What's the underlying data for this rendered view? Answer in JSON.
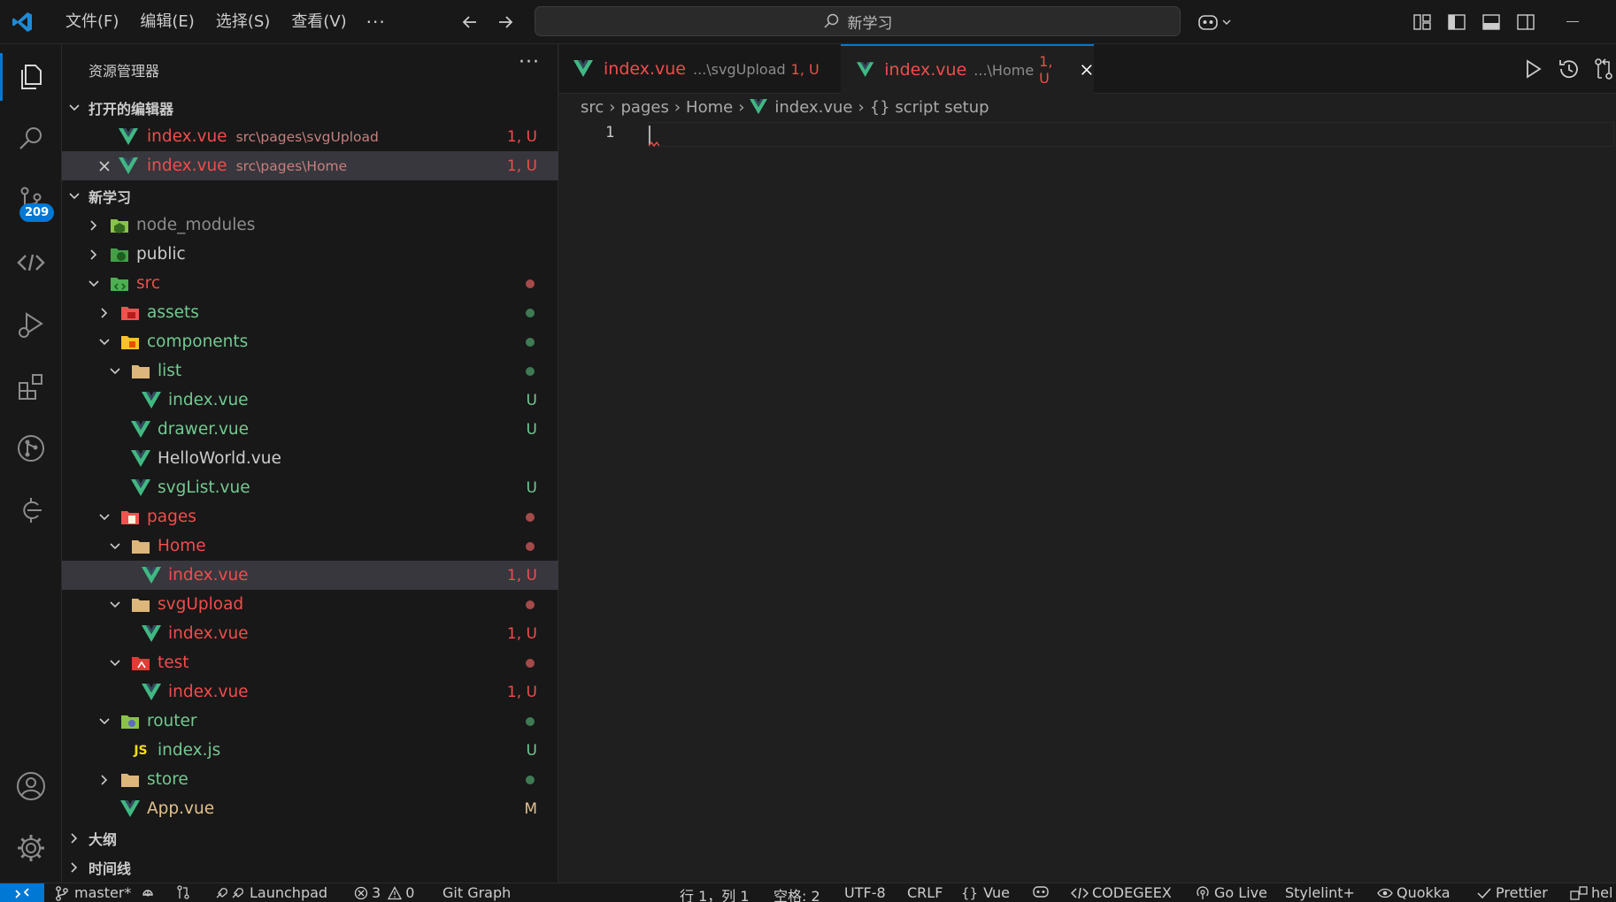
{
  "titlebar": {
    "menus": [
      "文件(F)",
      "编辑(E)",
      "选择(S)",
      "查看(V)"
    ],
    "more": "···",
    "search_text": "新学习"
  },
  "activity": {
    "scm_badge": "209"
  },
  "sidebar": {
    "title": "资源管理器",
    "more": "···",
    "open_editors": {
      "header": "打开的编辑器",
      "items": [
        {
          "name": "index.vue",
          "path": "src\\pages\\svgUpload",
          "status": "1, U"
        },
        {
          "name": "index.vue",
          "path": "src\\pages\\Home",
          "status": "1, U"
        }
      ]
    },
    "workspace": {
      "header": "新学习",
      "tree": [
        {
          "name": "node_modules"
        },
        {
          "name": "public"
        },
        {
          "name": "src"
        },
        {
          "name": "assets"
        },
        {
          "name": "components"
        },
        {
          "name": "list"
        },
        {
          "name": "index.vue",
          "status": "U"
        },
        {
          "name": "drawer.vue",
          "status": "U"
        },
        {
          "name": "HelloWorld.vue"
        },
        {
          "name": "svgList.vue",
          "status": "U"
        },
        {
          "name": "pages"
        },
        {
          "name": "Home"
        },
        {
          "name": "index.vue",
          "status": "1, U"
        },
        {
          "name": "svgUpload"
        },
        {
          "name": "index.vue",
          "status": "1, U"
        },
        {
          "name": "test"
        },
        {
          "name": "index.vue",
          "status": "1, U"
        },
        {
          "name": "router"
        },
        {
          "name": "index.js",
          "status": "U"
        },
        {
          "name": "store"
        },
        {
          "name": "App.vue",
          "status": "M"
        }
      ]
    },
    "outline": "大纲",
    "timeline": "时间线"
  },
  "tabs": [
    {
      "name": "index.vue",
      "desc": "...\\svgUpload",
      "status": "1, U"
    },
    {
      "name": "index.vue",
      "desc": "...\\Home",
      "status": "1, U"
    }
  ],
  "breadcrumb": [
    "src",
    "pages",
    "Home",
    "index.vue",
    "{} script setup"
  ],
  "editor": {
    "line_number": "1"
  },
  "statusbar": {
    "branch": "master*",
    "launchpad": "Launchpad",
    "errors": "3",
    "warnings": "0",
    "git_graph": "Git Graph",
    "position": "行 1，列 1",
    "spaces": "空格: 2",
    "encoding": "UTF-8",
    "eol": "CRLF",
    "language": "Vue",
    "codegeex": "CODEGEEX",
    "golive": "Go Live",
    "stylelint": "Stylelint+",
    "quokka": "Quokka",
    "prettier": "Prettier",
    "last": "hel"
  },
  "colors": {
    "accent": "#0078d4",
    "error_text": "#f14c4c",
    "untracked_text": "#73c991",
    "modified_text": "#e2c08d",
    "vue_green": "#41b883"
  }
}
